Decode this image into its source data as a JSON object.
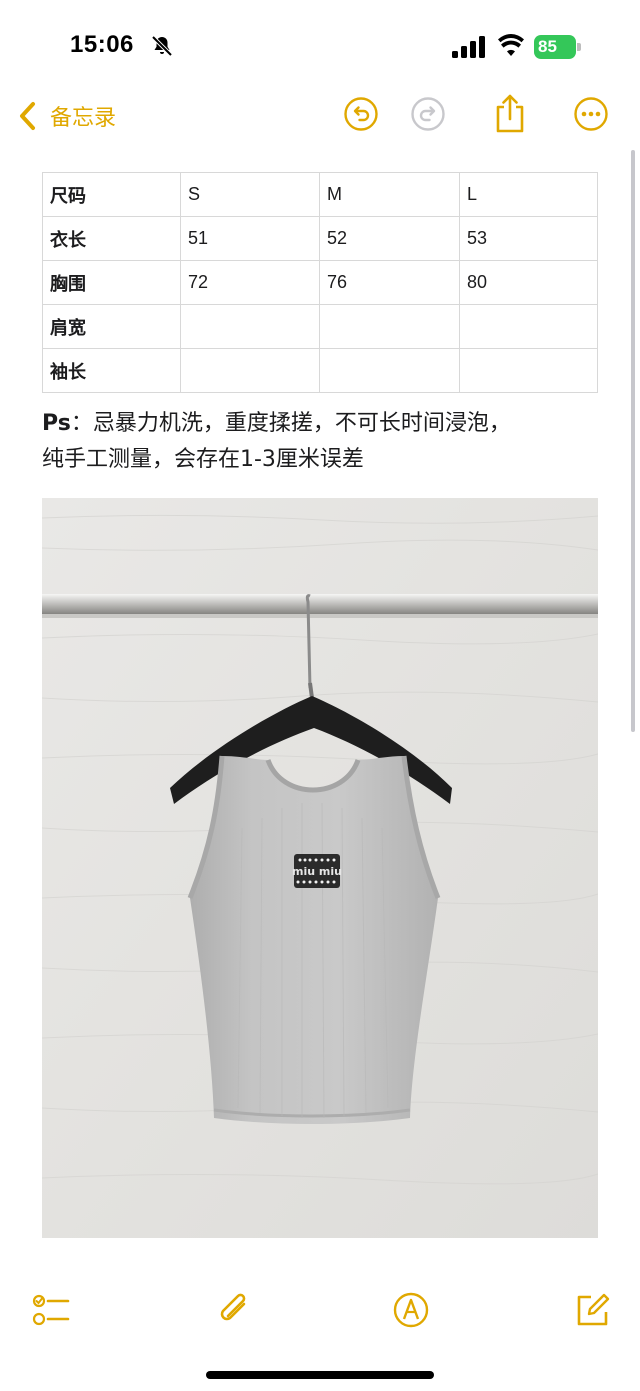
{
  "status_bar": {
    "time": "15:06",
    "battery": "85"
  },
  "nav": {
    "back_label": "备忘录",
    "icons": [
      "chevron-left-icon",
      "undo-icon",
      "redo-icon",
      "share-icon",
      "more-icon"
    ],
    "accent_color": "#e0a800"
  },
  "size_table": {
    "header": [
      "尺码",
      "S",
      "M",
      "L"
    ],
    "rows": [
      [
        "衣长",
        "51",
        "52",
        "53"
      ],
      [
        "胸围",
        "72",
        "76",
        "80"
      ],
      [
        "肩宽",
        "",
        "",
        ""
      ],
      [
        "袖长",
        "",
        "",
        ""
      ]
    ]
  },
  "note": {
    "prefix": "Ps",
    "line1": "：忌暴力机洗，重度揉搓，不可长时间浸泡，",
    "line2": "纯手工测量，会存在1-3厘米误差"
  },
  "photo": {
    "subject": "grey-tank-top-photo",
    "logo_text": "miu miu"
  },
  "toolbar": {
    "icons": [
      "checklist-icon",
      "paperclip-icon",
      "markup-pen-icon",
      "compose-icon"
    ]
  }
}
